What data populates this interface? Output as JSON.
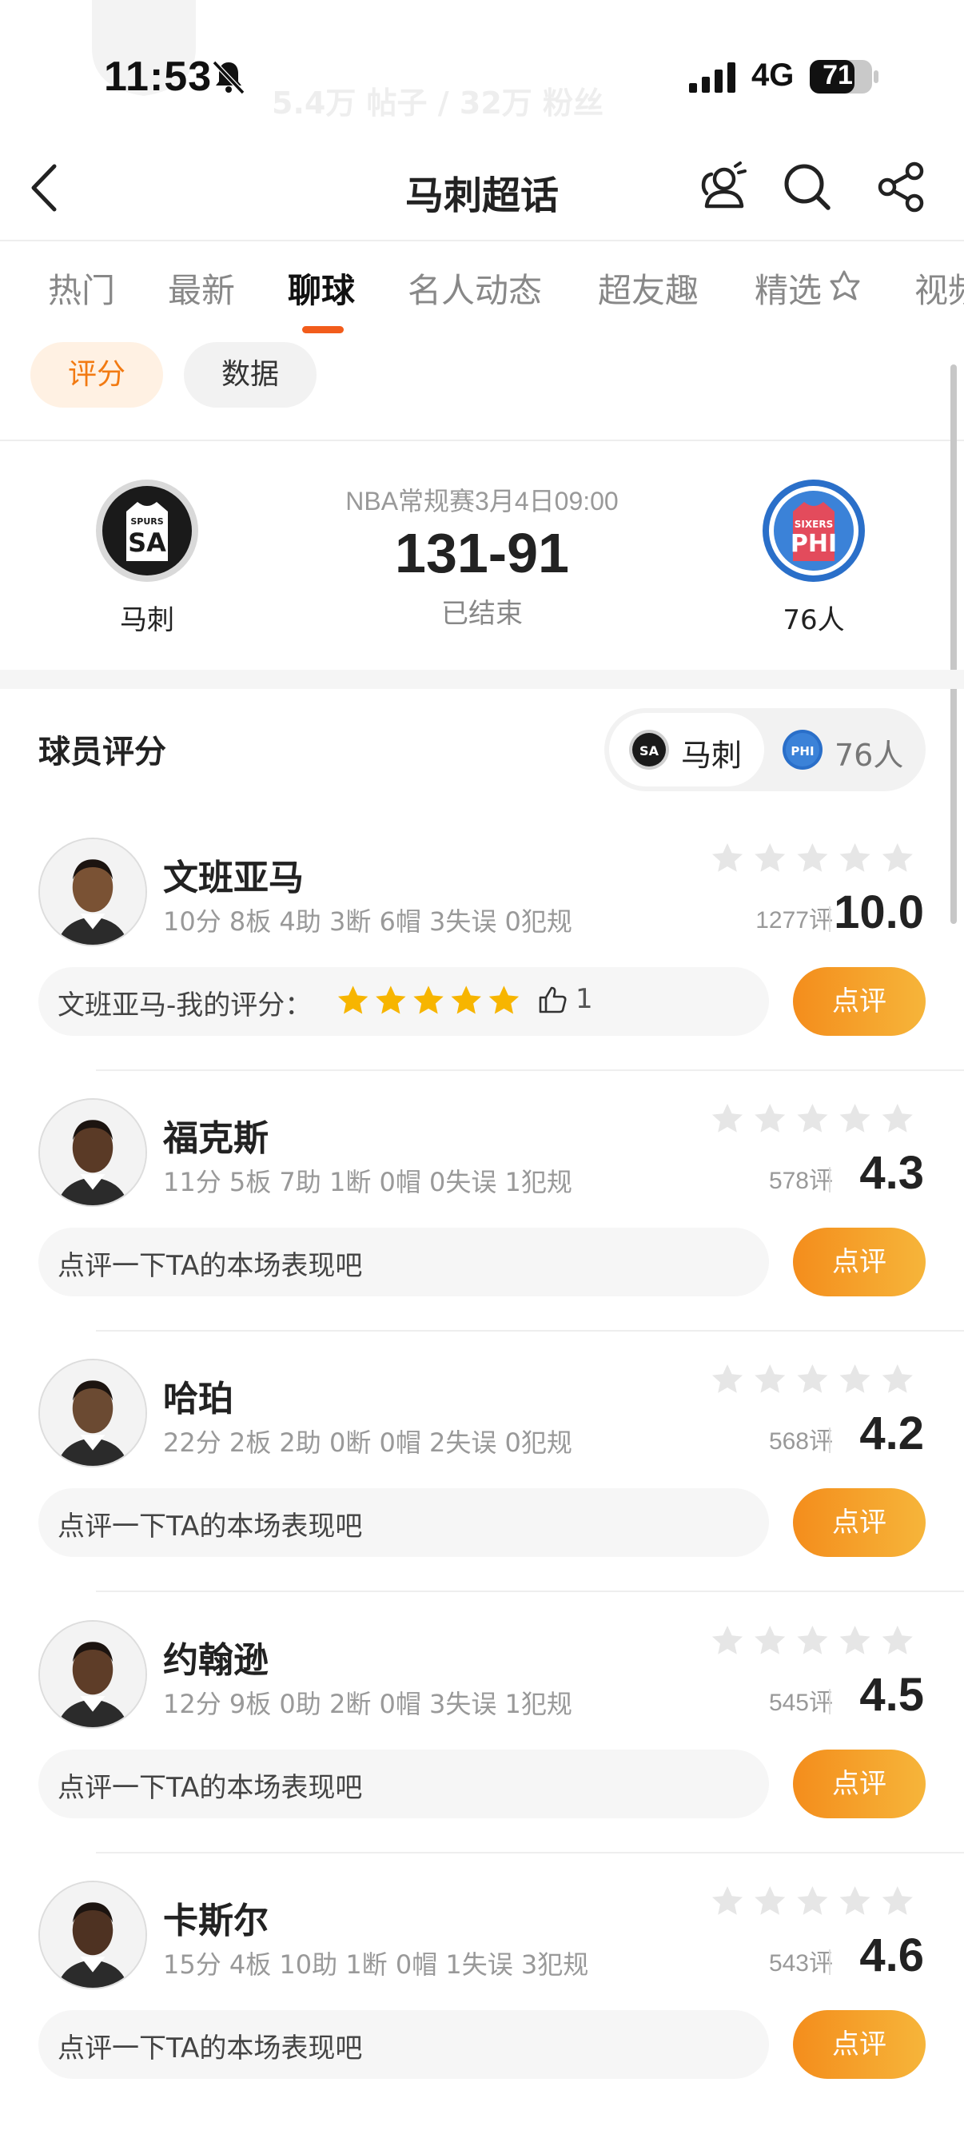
{
  "status_bar": {
    "time": "11:53",
    "network": "4G",
    "battery": "71",
    "bg_stats": "5.4万 帖子 / 32万 粉丝"
  },
  "nav": {
    "title": "马刺超话"
  },
  "tabs": [
    "热门",
    "最新",
    "聊球",
    "名人动态",
    "超友趣",
    "精选",
    "视频"
  ],
  "active_tab_index": 2,
  "sub_tabs": [
    "评分",
    "数据"
  ],
  "game": {
    "meta": "NBA常规赛3月4日09:00",
    "score": "131-91",
    "status": "已结束",
    "home": {
      "name": "马刺",
      "abbr": "SA",
      "small": "SPURS"
    },
    "away": {
      "name": "76人",
      "abbr": "PHI",
      "small": "SIXERS"
    }
  },
  "ratings": {
    "title": "球员评分",
    "toggle": [
      "马刺",
      "76人"
    ]
  },
  "players": [
    {
      "name": "文班亚马",
      "stats": "10分 8板 4助 3断 6帽 3失误 0犯规",
      "count": "1277评",
      "score": "10.0",
      "prompt": "文班亚马-我的评分：",
      "my_rating": 5,
      "likes": "1",
      "button": "点评"
    },
    {
      "name": "福克斯",
      "stats": "11分 5板 7助 1断 0帽 0失误 1犯规",
      "count": "578评",
      "score": "4.3",
      "prompt": "点评一下TA的本场表现吧",
      "button": "点评"
    },
    {
      "name": "哈珀",
      "stats": "22分 2板 2助 0断 0帽 2失误 0犯规",
      "count": "568评",
      "score": "4.2",
      "prompt": "点评一下TA的本场表现吧",
      "button": "点评"
    },
    {
      "name": "约翰逊",
      "stats": "12分 9板 0助 2断 0帽 3失误 1犯规",
      "count": "545评",
      "score": "4.5",
      "prompt": "点评一下TA的本场表现吧",
      "button": "点评"
    },
    {
      "name": "卡斯尔",
      "stats": "15分 4板 10助 1断 0帽 1失误 3犯规",
      "count": "543评",
      "score": "4.6",
      "prompt": "点评一下TA的本场表现吧",
      "button": "点评"
    }
  ],
  "colors": {
    "accent": "#f25c1b",
    "button_start": "#f48d1c",
    "button_end": "#f6b53a",
    "my_star": "#f7b500",
    "empty_star": "#e6e6e6",
    "spurs": "#1a1a1a",
    "sixers": "#2a6fc9"
  },
  "icons": {
    "back": "chevron-left-icon",
    "members": "people-icon",
    "search": "search-icon",
    "share": "share-icon",
    "bell": "bell-slash-icon",
    "signal": "signal-icon",
    "battery": "battery-icon",
    "like": "thumb-up-icon"
  }
}
